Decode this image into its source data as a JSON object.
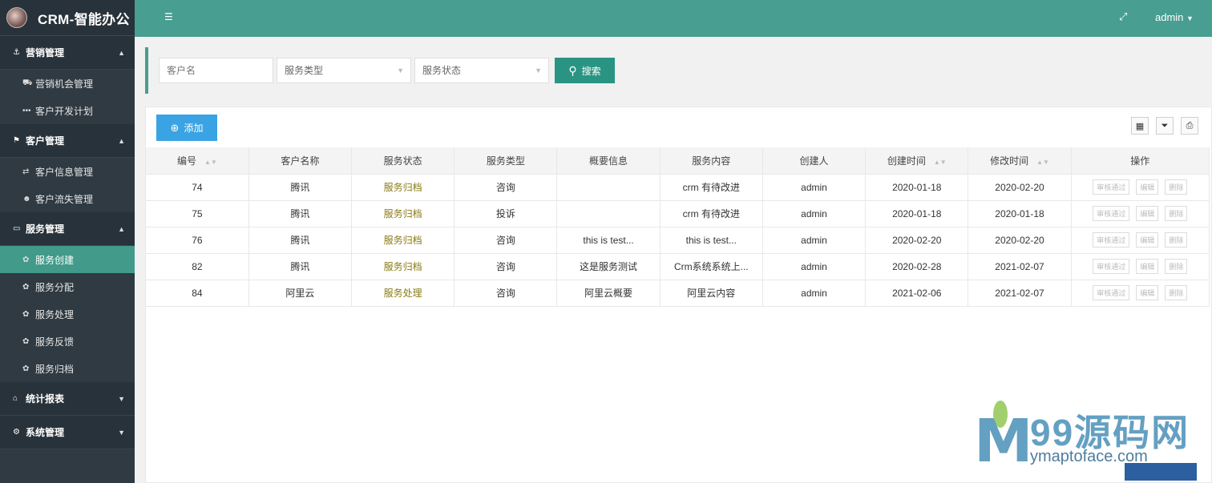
{
  "app": {
    "title": "CRM-智能办公"
  },
  "topbar": {
    "user": "admin"
  },
  "sidebar": {
    "groups": [
      {
        "label": "营销管理",
        "icon": "anchor-icon",
        "expanded": true,
        "items": [
          {
            "label": "营销机会管理",
            "icon": "car-icon"
          },
          {
            "label": "客户开发计划",
            "icon": "ellipsis-icon"
          }
        ]
      },
      {
        "label": "客户管理",
        "icon": "flag-icon",
        "expanded": true,
        "items": [
          {
            "label": "客户信息管理",
            "icon": "exchange-icon"
          },
          {
            "label": "客户流失管理",
            "icon": "user-times-icon"
          }
        ]
      },
      {
        "label": "服务管理",
        "icon": "desktop-icon",
        "expanded": true,
        "items": [
          {
            "label": "服务创建",
            "icon": "cog-icon"
          },
          {
            "label": "服务分配",
            "icon": "cog-icon"
          },
          {
            "label": "服务处理",
            "icon": "cog-icon"
          },
          {
            "label": "服务反馈",
            "icon": "cog-icon"
          },
          {
            "label": "服务归档",
            "icon": "cog-icon"
          }
        ]
      },
      {
        "label": "统计报表",
        "icon": "home-icon",
        "expanded": false,
        "items": []
      },
      {
        "label": "系统管理",
        "icon": "cogs-icon",
        "expanded": false,
        "items": []
      }
    ],
    "active_item": "服务创建"
  },
  "search": {
    "customer_placeholder": "客户名",
    "type_placeholder": "服务类型",
    "status_placeholder": "服务状态",
    "button_label": "搜索"
  },
  "toolbar": {
    "add_label": "添加"
  },
  "table": {
    "columns": [
      "编号",
      "客户名称",
      "服务状态",
      "服务类型",
      "概要信息",
      "服务内容",
      "创建人",
      "创建时间",
      "修改时间",
      "操作"
    ],
    "sortable": [
      "编号",
      "创建时间",
      "修改时间"
    ],
    "rows": [
      [
        "74",
        "腾讯",
        "服务归档",
        "咨询",
        "",
        "crm 有待改进",
        "admin",
        "2020-01-18",
        "2020-02-20"
      ],
      [
        "75",
        "腾讯",
        "服务归档",
        "投诉",
        "",
        "crm 有待改进",
        "admin",
        "2020-01-18",
        "2020-01-18"
      ],
      [
        "76",
        "腾讯",
        "服务归档",
        "咨询",
        "this is test...",
        "this is test...",
        "admin",
        "2020-02-20",
        "2020-02-20"
      ],
      [
        "82",
        "腾讯",
        "服务归档",
        "咨询",
        "这是服务测试",
        "Crm系统系统上...",
        "admin",
        "2020-02-28",
        "2021-02-07"
      ],
      [
        "84",
        "阿里云",
        "服务处理",
        "咨询",
        "阿里云概要",
        "阿里云内容",
        "admin",
        "2021-02-06",
        "2021-02-07"
      ]
    ],
    "actions": [
      "审核通过",
      "编辑",
      "删除"
    ]
  },
  "watermark": {
    "brand": "99源码网",
    "url": "ymaptoface.com"
  },
  "colors": {
    "sidebar": "#2f3a42",
    "topbar": "#489e90",
    "active": "#419a8a",
    "search_button": "#2a9483",
    "add_button": "#3aa3e3"
  }
}
